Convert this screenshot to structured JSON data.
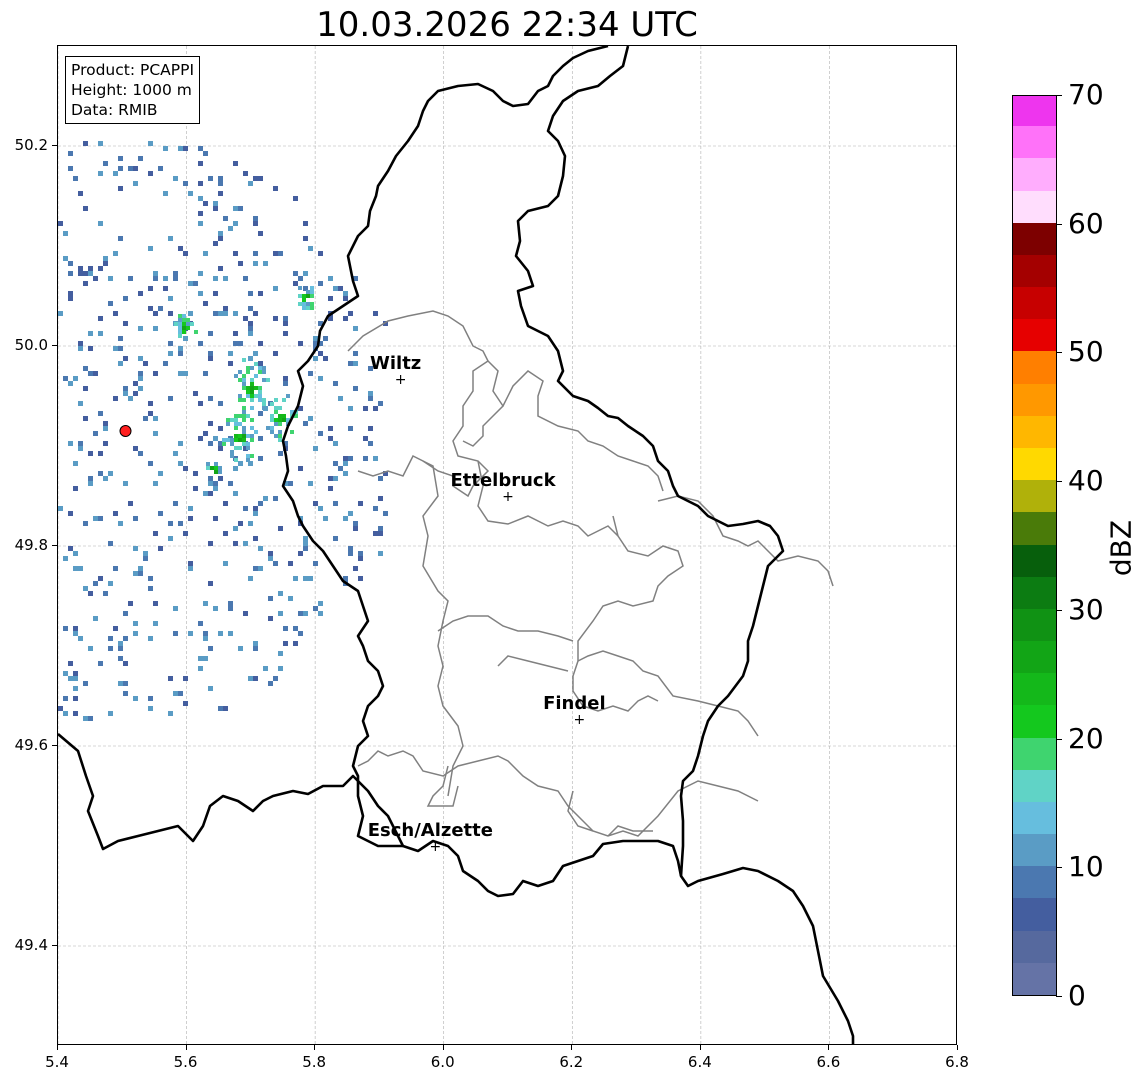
{
  "title": "10.03.2026 22:34 UTC",
  "info": {
    "product": "Product: PCAPPI",
    "height": "Height: 1000 m",
    "data": "Data: RMIB"
  },
  "axes": {
    "x_ticks": [
      "5.4",
      "5.6",
      "5.8",
      "6.0",
      "6.2",
      "6.4",
      "6.6",
      "6.8"
    ],
    "y_ticks": [
      "50.2",
      "50.0",
      "49.8",
      "49.6",
      "49.4"
    ],
    "lon_range": [
      5.4,
      6.8
    ],
    "lat_range": [
      49.3,
      50.3
    ],
    "grid": true
  },
  "colorbar": {
    "label": "dBZ",
    "ticks": [
      "0",
      "10",
      "20",
      "30",
      "40",
      "50",
      "60",
      "70"
    ],
    "range": [
      0,
      70
    ],
    "colors": [
      "#6573a6",
      "#56699e",
      "#445e9f",
      "#4b78b0",
      "#5a9cc5",
      "#66bede",
      "#60d3c6",
      "#3fd46f",
      "#14c81e",
      "#14b81a",
      "#12a516",
      "#109214",
      "#0c7c12",
      "#075f0c",
      "#4a7b09",
      "#b0b10a",
      "#ffd900",
      "#ffb700",
      "#ff9800",
      "#ff7f00",
      "#e60000",
      "#c70000",
      "#a40000",
      "#7d0000",
      "#ffddfd",
      "#ffadfd",
      "#ff72f9",
      "#ee35ee"
    ]
  },
  "radar_site": {
    "lon": 5.505,
    "lat": 49.915,
    "color": "#ff2020"
  },
  "cities": [
    {
      "name": "Wiltz",
      "lon": 5.933,
      "lat": 49.967
    },
    {
      "name": "Ettelbruck",
      "lon": 6.1,
      "lat": 49.85
    },
    {
      "name": "Findel",
      "lon": 6.211,
      "lat": 49.627
    },
    {
      "name": "Esch/Alzette",
      "lon": 5.987,
      "lat": 49.5
    }
  ]
}
